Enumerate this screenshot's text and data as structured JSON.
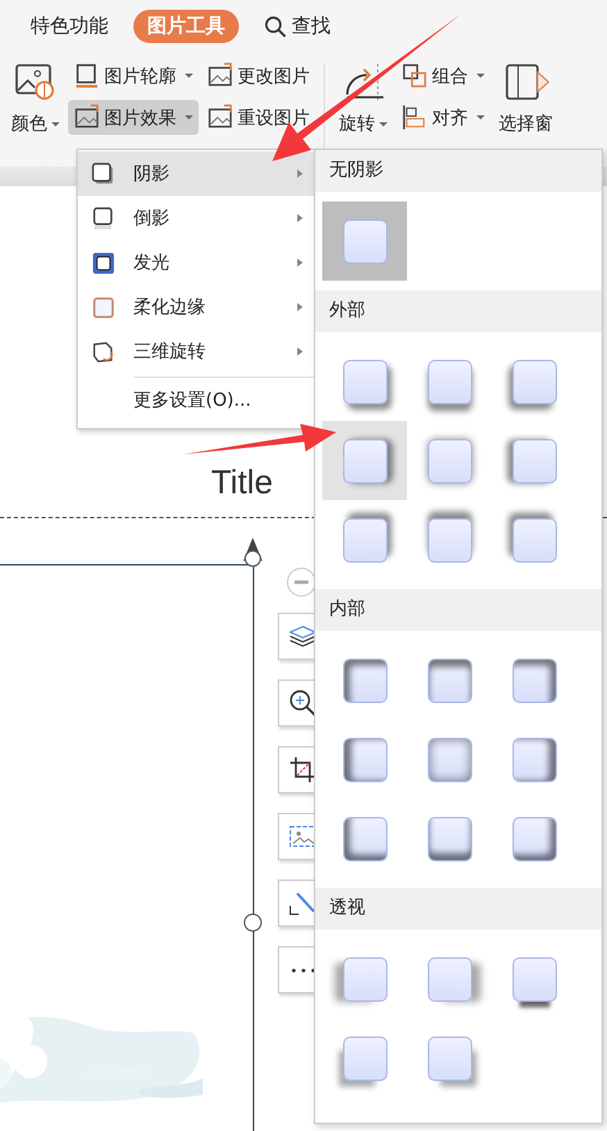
{
  "tabs": [
    {
      "label": "特色功能",
      "selected": false,
      "kind": "text"
    },
    {
      "label": "图片工具",
      "selected": true,
      "kind": "text"
    },
    {
      "label": "查找",
      "selected": false,
      "kind": "search"
    }
  ],
  "ribbon": {
    "groups": [
      {
        "kind": "big",
        "items": [
          {
            "label": "颜色",
            "kind": "color",
            "caret": true,
            "selected": false
          }
        ]
      },
      {
        "kind": "small",
        "items": [
          {
            "label": "图片轮廓",
            "kind": "outline",
            "caret": true,
            "selected": false
          },
          {
            "label": "图片效果",
            "kind": "effect",
            "caret": true,
            "selected": true
          }
        ]
      },
      {
        "kind": "small",
        "items": [
          {
            "label": "更改图片",
            "kind": "change",
            "caret": false,
            "selected": false
          },
          {
            "label": "重设图片",
            "kind": "reset",
            "caret": false,
            "selected": false
          }
        ]
      },
      {
        "kind": "divider"
      },
      {
        "kind": "big",
        "items": [
          {
            "label": "旋转",
            "kind": "rotate",
            "caret": true,
            "selected": false
          }
        ]
      },
      {
        "kind": "small",
        "items": [
          {
            "label": "组合",
            "kind": "group",
            "caret": true,
            "selected": false
          },
          {
            "label": "对齐",
            "kind": "align",
            "caret": true,
            "selected": false
          }
        ]
      },
      {
        "kind": "big",
        "items": [
          {
            "label": "选择窗",
            "kind": "pane",
            "caret": false,
            "selected": false
          }
        ]
      }
    ]
  },
  "effects_menu": {
    "items": [
      {
        "label": "阴影",
        "kind": "shadow",
        "submenu": true,
        "selected": true
      },
      {
        "label": "倒影",
        "kind": "reflection",
        "submenu": true,
        "selected": false
      },
      {
        "label": "发光",
        "kind": "glow",
        "submenu": true,
        "selected": false
      },
      {
        "label": "柔化边缘",
        "kind": "soft",
        "submenu": true,
        "selected": false
      },
      {
        "label": "三维旋转",
        "kind": "rotate3d",
        "submenu": true,
        "selected": false
      },
      {
        "label": "更多设置(O)...",
        "kind": "more",
        "submenu": false,
        "selected": false
      }
    ]
  },
  "shadow_submenu": {
    "sections": [
      {
        "header": "无阴影",
        "presets": [
          {
            "kind": "none",
            "selected": true,
            "hovered": false
          }
        ]
      },
      {
        "header": "外部",
        "presets": [
          {
            "kind": "outer-br",
            "selected": false,
            "hovered": false
          },
          {
            "kind": "outer-b",
            "selected": false,
            "hovered": false
          },
          {
            "kind": "outer-bl",
            "selected": false,
            "hovered": false
          },
          {
            "kind": "outer-r",
            "selected": false,
            "hovered": true
          },
          {
            "kind": "outer-c",
            "selected": false,
            "hovered": false
          },
          {
            "kind": "outer-l",
            "selected": false,
            "hovered": false
          },
          {
            "kind": "outer-tr",
            "selected": false,
            "hovered": false
          },
          {
            "kind": "outer-t",
            "selected": false,
            "hovered": false
          },
          {
            "kind": "outer-tl",
            "selected": false,
            "hovered": false
          }
        ]
      },
      {
        "header": "内部",
        "presets": [
          {
            "kind": "inner-tl",
            "selected": false,
            "hovered": false
          },
          {
            "kind": "inner-t",
            "selected": false,
            "hovered": false
          },
          {
            "kind": "inner-tr",
            "selected": false,
            "hovered": false
          },
          {
            "kind": "inner-l",
            "selected": false,
            "hovered": false
          },
          {
            "kind": "inner-c",
            "selected": false,
            "hovered": false
          },
          {
            "kind": "inner-r",
            "selected": false,
            "hovered": false
          },
          {
            "kind": "inner-bl",
            "selected": false,
            "hovered": false
          },
          {
            "kind": "inner-b",
            "selected": false,
            "hovered": false
          },
          {
            "kind": "inner-br",
            "selected": false,
            "hovered": false
          }
        ]
      },
      {
        "header": "透视",
        "presets": [
          {
            "kind": "persp-ul",
            "selected": false,
            "hovered": false
          },
          {
            "kind": "persp-ur",
            "selected": false,
            "hovered": false
          },
          {
            "kind": "persp-below",
            "selected": false,
            "hovered": false
          },
          {
            "kind": "persp-dl",
            "selected": false,
            "hovered": false
          },
          {
            "kind": "persp-dr",
            "selected": false,
            "hovered": false
          }
        ]
      }
    ]
  },
  "slide": {
    "title": "Title"
  }
}
